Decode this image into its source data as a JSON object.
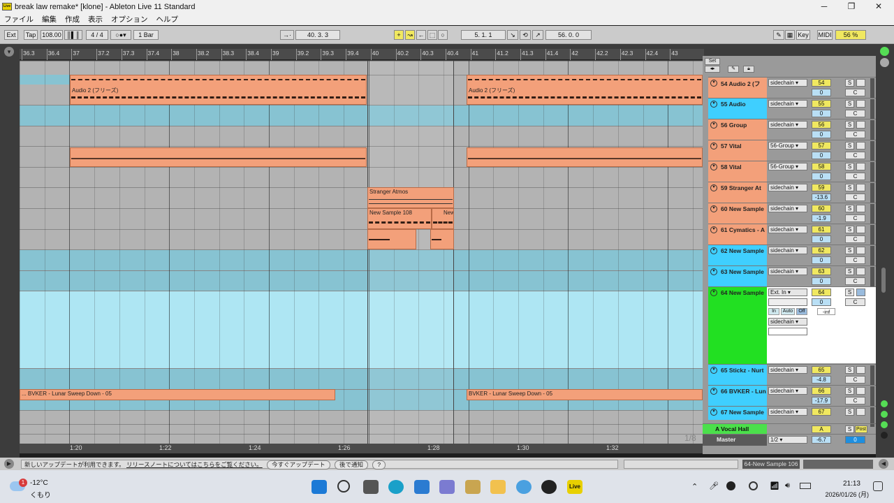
{
  "window": {
    "title": "break law remake* [klone] - Ableton Live 11 Standard",
    "app_icon_text": "Live",
    "minimize": "─",
    "maximize": "❐",
    "close": "✕"
  },
  "menu": [
    "ファイル",
    "編集",
    "作成",
    "表示",
    "オプション",
    "ヘルプ"
  ],
  "control_bar": {
    "ext": "Ext",
    "tap": "Tap",
    "tempo": "108.00",
    "signature": "4 / 4",
    "quantize": "1 Bar",
    "position": "40.  3.  3",
    "loop_start": "5.  1.  1",
    "loop_length": "56.  0.  0",
    "key": "Key",
    "midi": "MIDI",
    "cpu": "56 %"
  },
  "ruler": [
    "36.3",
    "36.4",
    "37",
    "37.2",
    "37.3",
    "37.4",
    "38",
    "38.2",
    "38.3",
    "38.4",
    "39",
    "39.2",
    "39.3",
    "39.4",
    "40",
    "40.2",
    "40.3",
    "40.4",
    "41",
    "41.2",
    "41.3",
    "41.4",
    "42",
    "42.2",
    "42.3",
    "42.4",
    "43"
  ],
  "bottom_ruler": [
    "1:20",
    "1:22",
    "1:24",
    "1:26",
    "1:28",
    "1:30",
    "1:32"
  ],
  "scale_label": "1/8",
  "clips": {
    "audio2_a": "Audio 2 (フリーズ)",
    "audio2_b": "Audio 2 (フリーズ)",
    "stranger": "Stranger Atmos",
    "newsample108": "New Sample 108",
    "newsample_cut": "New",
    "bvker_a": "... BVKER - Lunar Sweep Down - 05",
    "bvker_b": "BVKER - Lunar Sweep Down - 05"
  },
  "mixer": {
    "set_label": "Set",
    "tracks": [
      {
        "name": "54 Audio 2 (フ",
        "routing": "sidechain",
        "num": "54",
        "vol": "0",
        "pan": "C",
        "color": "#f3a07a"
      },
      {
        "name": "55 Audio",
        "routing": "sidechain",
        "num": "55",
        "vol": "0",
        "pan": "C",
        "color": "#3fcfff"
      },
      {
        "name": "56 Group",
        "routing": "sidechain",
        "num": "56",
        "vol": "0",
        "pan": "C",
        "color": "#f3a07a"
      },
      {
        "name": "57 Vital",
        "routing": "56-Group",
        "num": "57",
        "vol": "0",
        "pan": "C",
        "color": "#f3a07a"
      },
      {
        "name": "58 Vital",
        "routing": "56-Group",
        "num": "58",
        "vol": "0",
        "pan": "C",
        "color": "#f3a07a"
      },
      {
        "name": "59 Stranger At",
        "routing": "sidechain",
        "num": "59",
        "vol": "-13.6",
        "pan": "C",
        "color": "#f3a07a"
      },
      {
        "name": "60 New Sample",
        "routing": "sidechain",
        "num": "60",
        "vol": "-1.9",
        "pan": "C",
        "color": "#f3a07a"
      },
      {
        "name": "61 Cymatics - A",
        "routing": "sidechain",
        "num": "61",
        "vol": "0",
        "pan": "C",
        "color": "#f3a07a"
      },
      {
        "name": "62 New Sample",
        "routing": "sidechain",
        "num": "62",
        "vol": "0",
        "pan": "C",
        "color": "#3fcfff"
      },
      {
        "name": "63 New Sample",
        "routing": "sidechain",
        "num": "63",
        "vol": "0",
        "pan": "C",
        "color": "#3fcfff"
      }
    ],
    "selected_track": {
      "name": "64 New Sample",
      "routing": "Ext. In",
      "num": "64",
      "vol": "0",
      "pan": "C",
      "inf": "-inf",
      "in": "In",
      "auto": "Auto",
      "off": "Off",
      "routing2": "sidechain"
    },
    "tracks2": [
      {
        "name": "65 Stickz - Nurt",
        "routing": "sidechain",
        "num": "65",
        "vol": "-4.8",
        "pan": "C",
        "color": "#3fcfff"
      },
      {
        "name": "66 BVKER - Lun",
        "routing": "sidechain",
        "num": "66",
        "vol": "-17.9",
        "pan": "C",
        "color": "#3fcfff"
      },
      {
        "name": "67 New Sample",
        "routing": "sidechain",
        "num": "67",
        "vol": "",
        "pan": "",
        "color": "#3fcfff"
      }
    ],
    "return": {
      "name": "A Vocal Hall",
      "num": "A",
      "solo": "S",
      "post": "Post"
    },
    "master": {
      "name": "Master",
      "routing": "1/2",
      "vol": "-6.7",
      "pan": "0"
    }
  },
  "status": {
    "notice": "新しいアップデートが利用できます。",
    "link": "リリースノートについてはこちらをご覧ください。",
    "update_now": "今すぐアップデート",
    "later": "後で通知",
    "help": "?",
    "selected": "64-New Sample 106"
  },
  "taskbar": {
    "temp": "-12°C",
    "weather": "くもり",
    "badge": "1",
    "time": "21:13",
    "date": "2026/01/26 (月)"
  }
}
